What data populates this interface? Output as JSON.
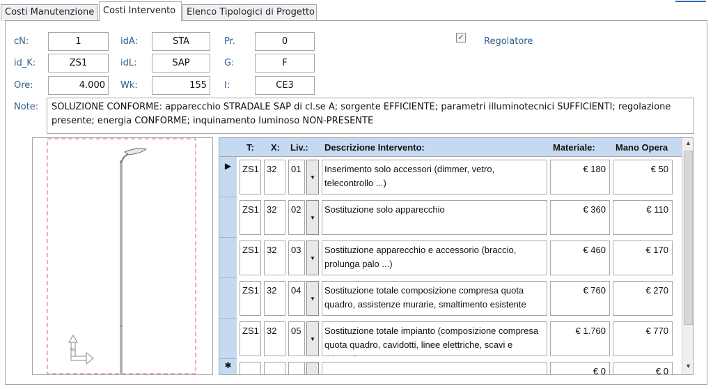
{
  "tabs": [
    {
      "label": "Costi Manutenzione"
    },
    {
      "label": "Costi Intervento"
    },
    {
      "label": "Elenco Tipologici di Progetto"
    }
  ],
  "form": {
    "cn_label": "cN:",
    "cn_value": "1",
    "ida_label": "idA:",
    "ida_value": "STA",
    "pr_label": "Pr.",
    "pr_value": "0",
    "idk_label": "id_K:",
    "idk_value": "ZS1",
    "idl_label": "idL:",
    "idl_value": "SAP",
    "g_label": "G:",
    "g_value": "F",
    "ore_label": "Ore:",
    "ore_value": "4.000",
    "wk_label": "Wk:",
    "wk_value": "155",
    "i_label": "I:",
    "i_value": "CE3",
    "regolatore_label": "Regolatore",
    "regolatore_checked": "✓",
    "note_label": "Note:",
    "note_value": "SOLUZIONE CONFORME: apparecchio STRADALE SAP di cl.se A; sorgente EFFICIENTE; parametri illuminotecnici SUFFICIENTI; regolazione presente; energia CONFORME; inquinamento luminoso NON-PRESENTE"
  },
  "grid": {
    "headers": {
      "t": "T:",
      "x": "X:",
      "liv": "Liv.:",
      "desc": "Descrizione Intervento:",
      "mat": "Materiale:",
      "mano": "Mano Opera"
    },
    "rows": [
      {
        "t": "ZS1",
        "x": "32",
        "liv": "01",
        "desc": "Inserimento solo accessori (dimmer, vetro, telecontrollo ...)",
        "mat": "€ 180",
        "mano": "€ 50"
      },
      {
        "t": "ZS1",
        "x": "32",
        "liv": "02",
        "desc": "Sostituzione solo apparecchio",
        "mat": "€ 360",
        "mano": "€ 110"
      },
      {
        "t": "ZS1",
        "x": "32",
        "liv": "03",
        "desc": "Sostituzione apparecchio e accessorio (braccio, prolunga palo ...)",
        "mat": "€ 460",
        "mano": "€ 170"
      },
      {
        "t": "ZS1",
        "x": "32",
        "liv": "04",
        "desc": "Sostituzione totale composizione compresa quota quadro, assistenze murarie,  smaltimento esistente",
        "mat": "€ 760",
        "mano": "€ 270"
      },
      {
        "t": "ZS1",
        "x": "32",
        "liv": "05",
        "desc": "Sostituzione totale impianto (composizione compresa quota quadro, cavidotti, linee elettriche, scavi e reinterri)",
        "mat": "€ 1.760",
        "mano": "€ 770"
      }
    ],
    "new_row": {
      "mat": "€ 0",
      "mano": "€ 0"
    },
    "current_row_marker": "▶",
    "new_row_marker": "✱"
  },
  "colors": {
    "label_blue": "#2e5d8c",
    "header_blue": "#c5d9f1",
    "border_gray": "#a6a6a6",
    "dashed_red": "#e06060"
  }
}
